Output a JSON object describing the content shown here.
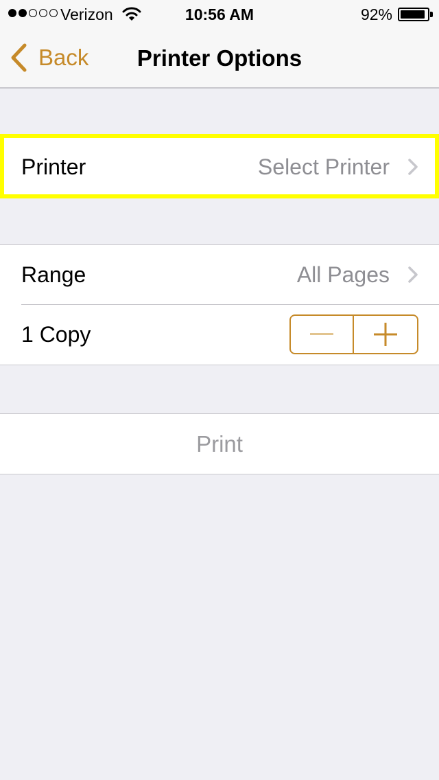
{
  "status_bar": {
    "carrier": "Verizon",
    "signal_bars": 2,
    "signal_total": 5,
    "time": "10:56 AM",
    "battery_percent": "92%",
    "battery_level": 0.92
  },
  "nav": {
    "back_label": "Back",
    "title": "Printer Options"
  },
  "printer_row": {
    "label": "Printer",
    "value": "Select Printer"
  },
  "range_row": {
    "label": "Range",
    "value": "All Pages"
  },
  "copies_row": {
    "label": "1 Copy",
    "minus_enabled": false,
    "plus_enabled": true
  },
  "print_button": {
    "label": "Print",
    "enabled": false
  },
  "colors": {
    "accent": "#c68a29",
    "highlight": "#ffff00",
    "background": "#efeff4",
    "secondary_text": "#8e8e93"
  },
  "icons": [
    "signal-dots-icon",
    "wifi-icon",
    "battery-icon",
    "back-chevron-icon",
    "chevron-right-icon",
    "minus-icon",
    "plus-icon"
  ]
}
